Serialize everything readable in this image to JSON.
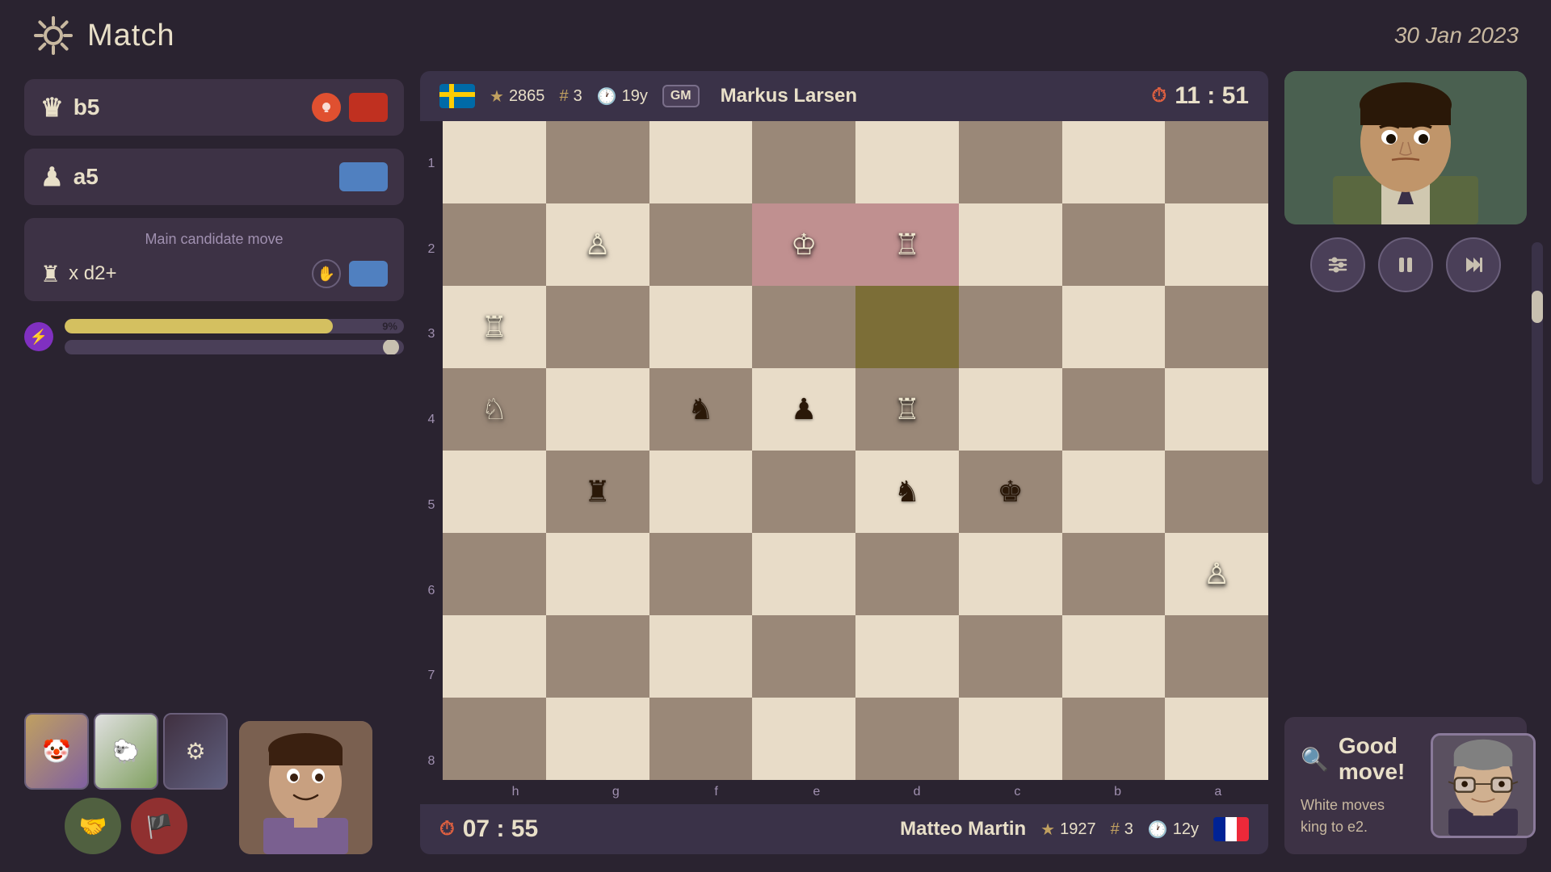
{
  "header": {
    "title": "Match",
    "date": "30 Jan 2023",
    "gear_label": "Settings"
  },
  "top_player": {
    "flag": "sweden",
    "rating": "2865",
    "rank": "3",
    "age": "19y",
    "gm_badge": "GM",
    "name": "Markus Larsen",
    "timer": "11 : 51"
  },
  "bottom_player": {
    "flag": "france",
    "rating": "1927",
    "rank": "3",
    "age": "12y",
    "name": "Matteo Martin",
    "timer": "07 : 55"
  },
  "moves": {
    "move1_label": "b5",
    "move2_label": "a5",
    "candidate_title": "Main candidate move",
    "candidate_move": "x d2+"
  },
  "progress": {
    "bar1_percent": 79,
    "bar1_label": "9%"
  },
  "analysis": {
    "good_move": "Good move!",
    "description": "White moves king to e2."
  },
  "controls": {
    "settings_label": "⚙",
    "pause_label": "⏸",
    "skip_label": "⏭"
  },
  "board": {
    "col_labels": [
      "h",
      "g",
      "f",
      "e",
      "d",
      "c",
      "b",
      "a"
    ],
    "row_labels": [
      "1",
      "2",
      "3",
      "4",
      "5",
      "6",
      "7",
      "8"
    ]
  },
  "avatars": {
    "card1_label": "🤡",
    "card2_label": "🐑",
    "card3_label": "⚙"
  }
}
